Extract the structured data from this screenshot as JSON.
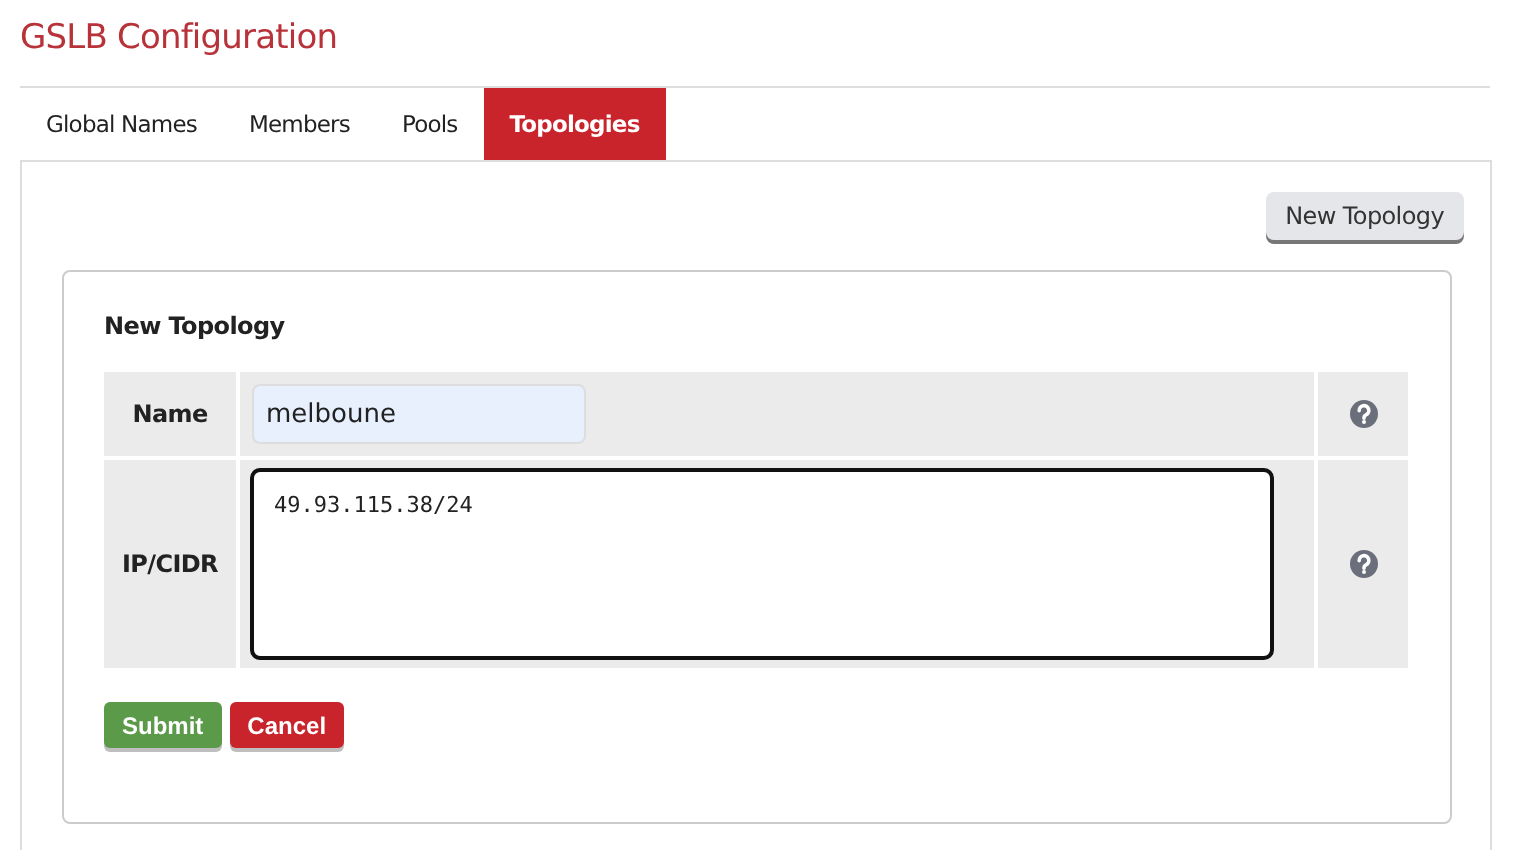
{
  "title": "GSLB Configuration",
  "tabs": [
    {
      "label": "Global Names",
      "selected": false
    },
    {
      "label": "Members",
      "selected": false
    },
    {
      "label": "Pools",
      "selected": false
    },
    {
      "label": "Topologies",
      "selected": true
    }
  ],
  "toolbar_button": "New Topology",
  "form": {
    "heading": "New Topology",
    "fields": [
      {
        "kind": "input",
        "label": "Name",
        "value": "melboune",
        "autofilled": true
      },
      {
        "kind": "textarea",
        "label": "IP/CIDR",
        "value": "49.93.115.38/24",
        "focused": true
      }
    ],
    "buttons": [
      {
        "kind": "primary",
        "label": "Submit"
      },
      {
        "kind": "danger",
        "label": "Cancel"
      }
    ]
  }
}
